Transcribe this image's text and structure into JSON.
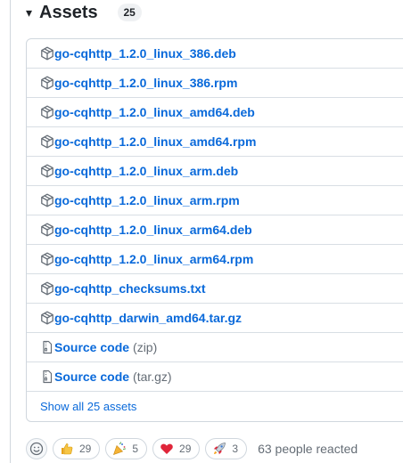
{
  "header": {
    "caret": "▾",
    "title": "Assets",
    "count": "25"
  },
  "assets": [
    {
      "name": "go-cqhttp_1.2.0_linux_386.deb",
      "ext": "",
      "icon": "package-icon"
    },
    {
      "name": "go-cqhttp_1.2.0_linux_386.rpm",
      "ext": "",
      "icon": "package-icon"
    },
    {
      "name": "go-cqhttp_1.2.0_linux_amd64.deb",
      "ext": "",
      "icon": "package-icon"
    },
    {
      "name": "go-cqhttp_1.2.0_linux_amd64.rpm",
      "ext": "",
      "icon": "package-icon"
    },
    {
      "name": "go-cqhttp_1.2.0_linux_arm.deb",
      "ext": "",
      "icon": "package-icon"
    },
    {
      "name": "go-cqhttp_1.2.0_linux_arm.rpm",
      "ext": "",
      "icon": "package-icon"
    },
    {
      "name": "go-cqhttp_1.2.0_linux_arm64.deb",
      "ext": "",
      "icon": "package-icon"
    },
    {
      "name": "go-cqhttp_1.2.0_linux_arm64.rpm",
      "ext": "",
      "icon": "package-icon"
    },
    {
      "name": "go-cqhttp_checksums.txt",
      "ext": "",
      "icon": "package-icon"
    },
    {
      "name": "go-cqhttp_darwin_amd64.tar.gz",
      "ext": "",
      "icon": "package-icon"
    },
    {
      "name": "Source code",
      "ext": "(zip)",
      "icon": "file-zip-icon"
    },
    {
      "name": "Source code",
      "ext": "(tar.gz)",
      "icon": "file-zip-icon"
    }
  ],
  "show_all_label": "Show all 25 assets",
  "reactions": {
    "items": [
      {
        "emoji": "thumbs-up-icon",
        "count": "29"
      },
      {
        "emoji": "hooray-icon",
        "count": "5"
      },
      {
        "emoji": "heart-icon",
        "count": "29"
      },
      {
        "emoji": "rocket-icon",
        "count": "3"
      }
    ],
    "summary": "63 people reacted"
  },
  "colors": {
    "link": "#0969da",
    "muted": "#656d76",
    "border": "#d0d7de",
    "badge_bg": "#eff1f3"
  }
}
